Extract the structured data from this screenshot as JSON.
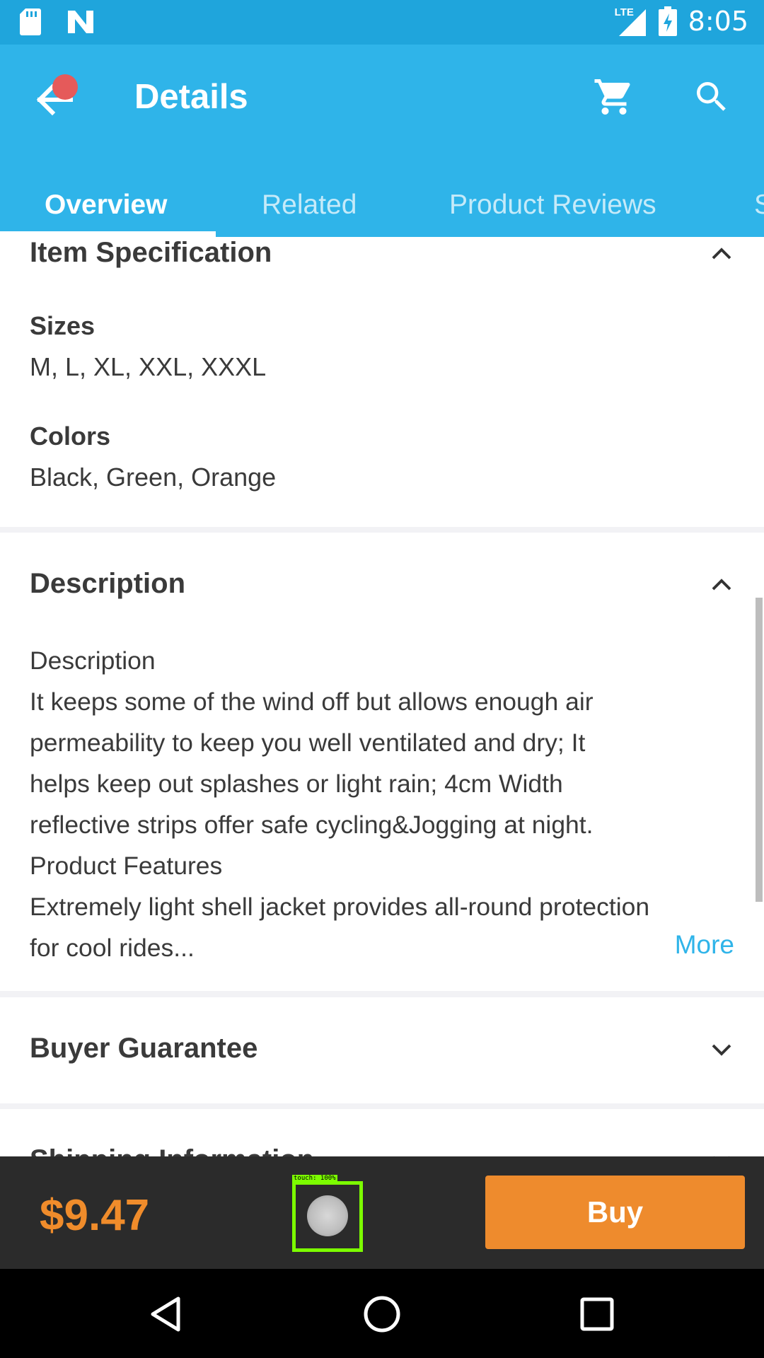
{
  "status_bar": {
    "time": "8:05",
    "network": "LTE",
    "icons": [
      "sd-card-icon",
      "n-app-icon",
      "lte-signal-icon",
      "battery-charging-icon"
    ]
  },
  "app_bar": {
    "title": "Details",
    "tabs": [
      {
        "label": "Overview",
        "active": true
      },
      {
        "label": "Related",
        "active": false
      },
      {
        "label": "Product Reviews",
        "active": false
      },
      {
        "label": "S",
        "active": false
      }
    ]
  },
  "item_spec": {
    "title": "Item Specification",
    "sizes_label": "Sizes",
    "sizes_value": "M, L, XL, XXL, XXXL",
    "colors_label": "Colors",
    "colors_value": "Black, Green, Orange"
  },
  "description": {
    "title": "Description",
    "lines": [
      "Description",
      "It keeps some of the wind off but allows enough air permeability to keep you well ventilated and dry; It helps keep out splashes or light rain; 4cm Width reflective strips offer safe cycling&Jogging at night.",
      "Product Features",
      "Extremely light shell jacket provides all-round protection for cool rides..."
    ],
    "more_label": "More"
  },
  "buyer_guarantee": {
    "title": "Buyer Guarantee"
  },
  "shipping": {
    "title": "Shipping Information"
  },
  "buy_bar": {
    "price": "$9.47",
    "buy_label": "Buy",
    "touch_label": "touch: 100%"
  },
  "colors": {
    "accent": "#2fb4e9",
    "status_bar": "#1fa5dc",
    "price": "#f08c2b",
    "buy_button": "#ee8b2d"
  }
}
